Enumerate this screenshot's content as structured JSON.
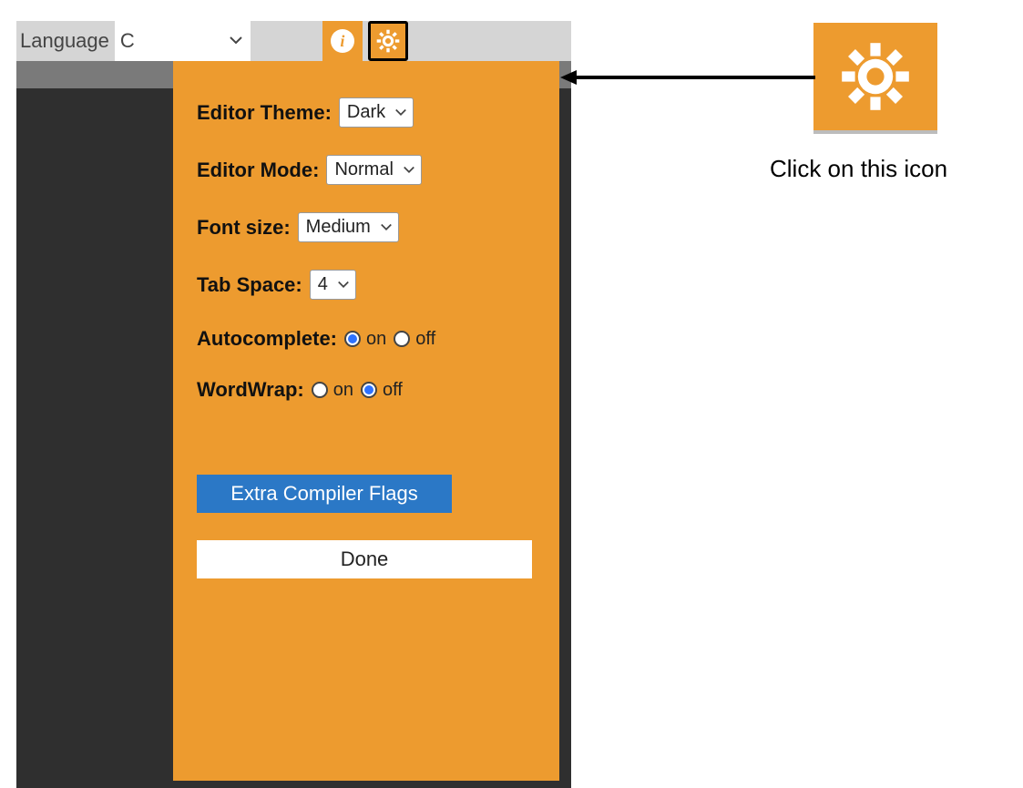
{
  "topbar": {
    "language_label": "Language",
    "language_value": "C"
  },
  "settings": {
    "theme_label": "Editor Theme:",
    "theme_value": "Dark",
    "mode_label": "Editor Mode:",
    "mode_value": "Normal",
    "font_label": "Font size:",
    "font_value": "Medium",
    "tab_label": "Tab Space:",
    "tab_value": "4",
    "autocomplete_label": "Autocomplete:",
    "autocomplete_on": "on",
    "autocomplete_off": "off",
    "autocomplete_value": "on",
    "wordwrap_label": "WordWrap:",
    "wordwrap_on": "on",
    "wordwrap_off": "off",
    "wordwrap_value": "off",
    "flags_button": "Extra Compiler Flags",
    "done_button": "Done"
  },
  "annotation": {
    "text": "Click on this icon"
  }
}
